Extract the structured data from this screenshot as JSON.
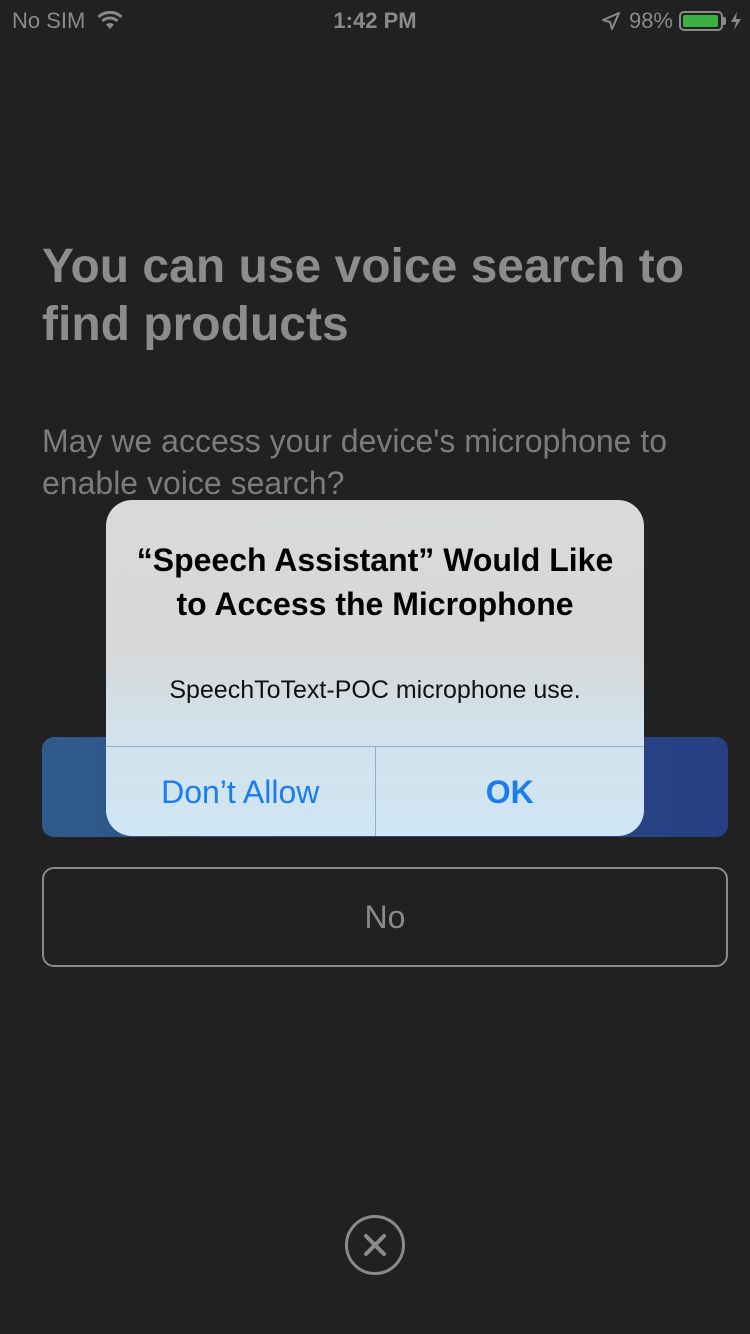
{
  "status_bar": {
    "carrier": "No SIM",
    "time": "1:42 PM",
    "battery_percent": "98%",
    "battery_level": 0.98,
    "icons": [
      "wifi-icon",
      "location-arrow-icon",
      "battery-icon",
      "charging-bolt-icon"
    ],
    "battery_color": "#3cb043"
  },
  "main": {
    "headline": "You can use voice search to find products",
    "subtext": "May we access your device's microphone to enable voice search?",
    "yes_button_color": "#2a4a86",
    "no_label": "No",
    "close_icon": "close-icon"
  },
  "alert": {
    "title": "“Speech Assistant” Would Like to Access the Microphone",
    "message": "SpeechToText-POC microphone use.",
    "dont_allow_label": "Don’t Allow",
    "ok_label": "OK",
    "button_color": "#1a7cf0"
  }
}
